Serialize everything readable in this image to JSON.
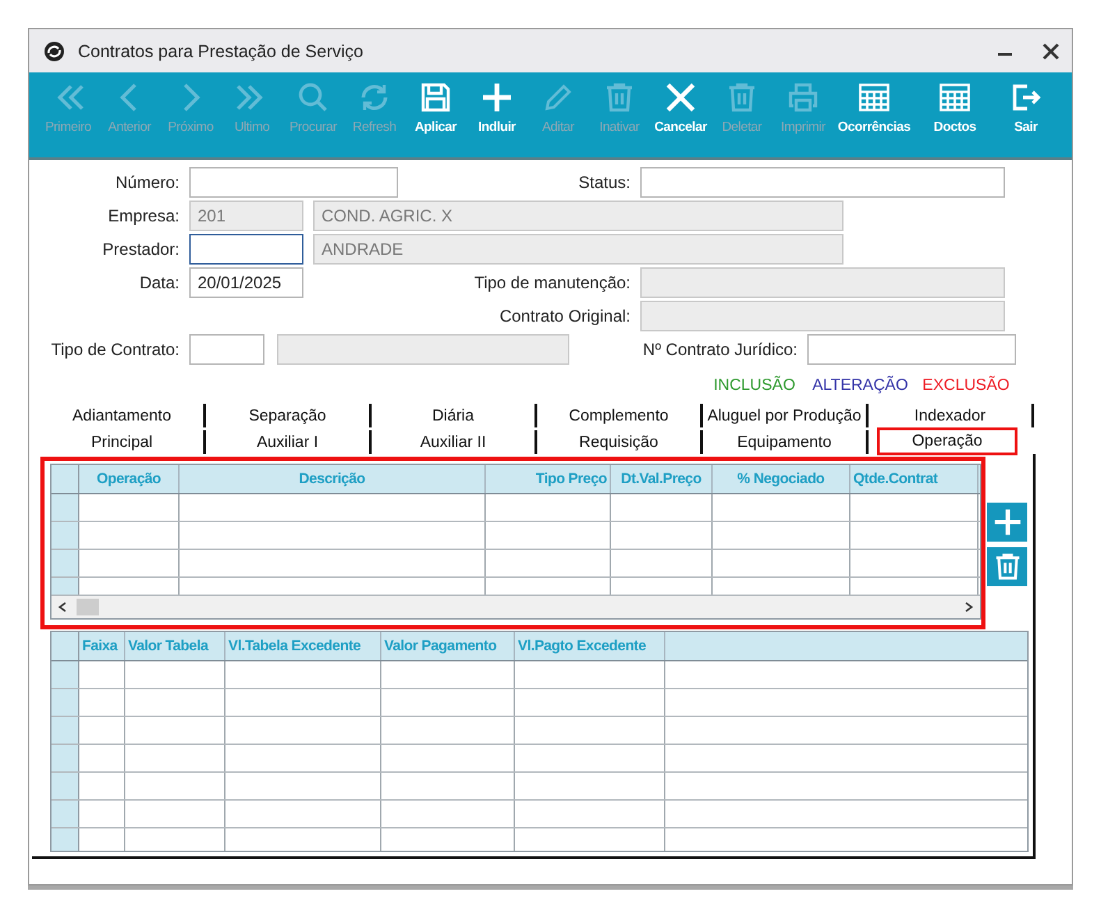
{
  "window": {
    "title": "Contratos para Prestação de Serviço"
  },
  "toolbar": [
    {
      "label": "Primeiro",
      "disabled": true
    },
    {
      "label": "Anterior",
      "disabled": true
    },
    {
      "label": "Próximo",
      "disabled": true
    },
    {
      "label": "Ultimo",
      "disabled": true
    },
    {
      "label": "Procurar",
      "disabled": true
    },
    {
      "label": "Refresh",
      "disabled": true
    },
    {
      "label": "Aplicar",
      "disabled": false
    },
    {
      "label": "Indluir",
      "disabled": false
    },
    {
      "label": "Aditar",
      "disabled": true
    },
    {
      "label": "Inativar",
      "disabled": true
    },
    {
      "label": "Cancelar",
      "disabled": false
    },
    {
      "label": "Deletar",
      "disabled": true
    },
    {
      "label": "Imprimir",
      "disabled": true
    },
    {
      "label": "Ocorrências",
      "disabled": false
    },
    {
      "label": "Doctos",
      "disabled": false
    },
    {
      "label": "Sair",
      "disabled": false
    }
  ],
  "form": {
    "numero": {
      "label": "Número:"
    },
    "status": {
      "label": "Status:"
    },
    "empresa": {
      "label": "Empresa:",
      "code": "201",
      "name": "COND. AGRIC. X"
    },
    "prestador": {
      "label": "Prestador:",
      "name": "ANDRADE",
      "focused": true
    },
    "data": {
      "label": "Data:",
      "value": "20/01/2025"
    },
    "tipo_manutencao": {
      "label": "Tipo de manutenção:"
    },
    "contrato_original": {
      "label": "Contrato Original:"
    },
    "tipo_contrato": {
      "label": "Tipo de Contrato:"
    },
    "contrato_juridico": {
      "label": "Nº Contrato Jurídico:"
    }
  },
  "legend": [
    {
      "label": "INCLUSÃO",
      "color": "#2f9a2f"
    },
    {
      "label": "ALTERAÇÃO",
      "color": "#3434a8"
    },
    {
      "label": "EXCLUSÃO",
      "color": "#ee1c24"
    }
  ],
  "tabs": [
    [
      {
        "label": "Adiantamento",
        "selected": false
      },
      {
        "label": "Separação",
        "selected": false
      },
      {
        "label": "Diária",
        "selected": false
      },
      {
        "label": "Complemento",
        "selected": false
      },
      {
        "label": "Aluguel por Produção",
        "selected": false
      },
      {
        "label": "Indexador",
        "selected": false
      }
    ],
    [
      {
        "label": "Principal",
        "selected": false
      },
      {
        "label": "Auxiliar I",
        "selected": false
      },
      {
        "label": "Auxiliar II",
        "selected": false
      },
      {
        "label": "Requisição",
        "selected": false
      },
      {
        "label": "Equipamento",
        "selected": false
      },
      {
        "label": "Operação",
        "selected": true
      }
    ]
  ],
  "operations_table": {
    "columns": [
      {
        "label": "Operação"
      },
      {
        "label": "Descrição"
      },
      {
        "label": "Tipo Preço"
      },
      {
        "label": "Dt.Val.Preço"
      },
      {
        "label": "% Negociado"
      },
      {
        "label": "Qtde.Contrat"
      }
    ]
  },
  "bands_table": {
    "columns": [
      {
        "label": "Faixa"
      },
      {
        "label": "Valor Tabela"
      },
      {
        "label": "Vl.Tabela Excedente"
      },
      {
        "label": "Valor Pagamento"
      },
      {
        "label": "Vl.Pagto Excedente"
      }
    ]
  }
}
